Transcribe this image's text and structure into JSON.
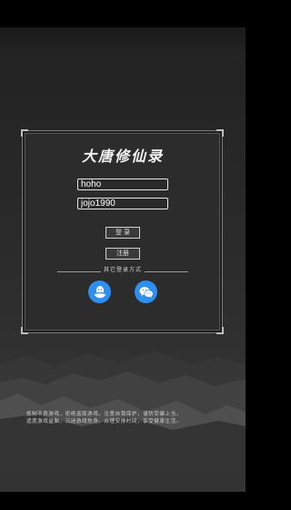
{
  "app": {
    "title": "大唐修仙录"
  },
  "login_form": {
    "username_value": "hoho",
    "password_value": "jojo1990",
    "login_label": "登 录",
    "register_label": "注册"
  },
  "other_login": {
    "label": "其它登录方式",
    "providers": [
      {
        "name": "qq-icon",
        "color": "#2f8ff0"
      },
      {
        "name": "wechat-icon",
        "color": "#2f8ff0"
      }
    ]
  },
  "health_notice": {
    "line1": "抵制不良游戏，拒绝盗版游戏。注意自我保护，谨防受骗上当。",
    "line2": "适度游戏益脑，沉迷游戏伤身。合理安排时间，享受健康生活。"
  },
  "colors": {
    "panel_bg": "#2c2c2c",
    "social_button": "#2f8ff0"
  }
}
